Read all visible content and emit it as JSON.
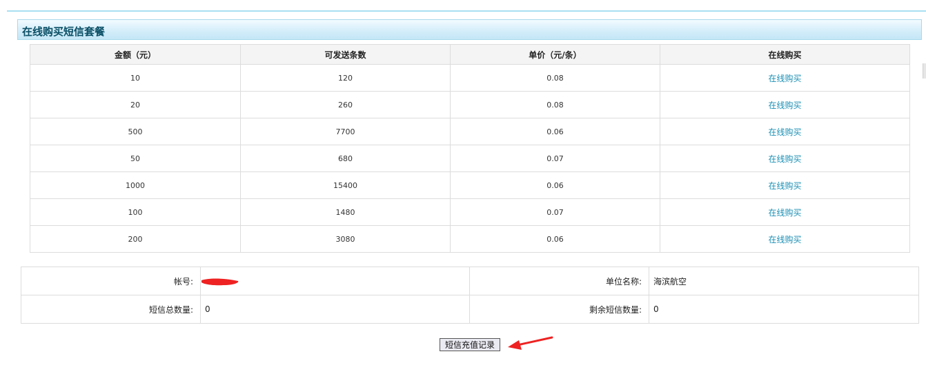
{
  "panel": {
    "title": "在线购买短信套餐"
  },
  "packages": {
    "headers": [
      "金额（元）",
      "可发送条数",
      "单价（元/条）",
      "在线购买"
    ],
    "rows": [
      {
        "amount": "10",
        "count": "120",
        "price": "0.08",
        "buy_label": "在线购买"
      },
      {
        "amount": "20",
        "count": "260",
        "price": "0.08",
        "buy_label": "在线购买"
      },
      {
        "amount": "500",
        "count": "7700",
        "price": "0.06",
        "buy_label": "在线购买"
      },
      {
        "amount": "50",
        "count": "680",
        "price": "0.07",
        "buy_label": "在线购买"
      },
      {
        "amount": "1000",
        "count": "15400",
        "price": "0.06",
        "buy_label": "在线购买"
      },
      {
        "amount": "100",
        "count": "1480",
        "price": "0.07",
        "buy_label": "在线购买"
      },
      {
        "amount": "200",
        "count": "3080",
        "price": "0.06",
        "buy_label": "在线购买"
      }
    ]
  },
  "account": {
    "account_label": "帐号:",
    "account_value": "",
    "unit_label": "单位名称:",
    "unit_value": "海滨航空",
    "total_label": "短信总数量:",
    "total_value": "0",
    "remaining_label": "剩余短信数量:",
    "remaining_value": "0"
  },
  "actions": {
    "record_button": "短信充值记录"
  },
  "colors": {
    "link": "#1a8fb5",
    "header_text": "#0a4f66",
    "redaction": "#ee2222",
    "arrow": "#ee2222"
  }
}
